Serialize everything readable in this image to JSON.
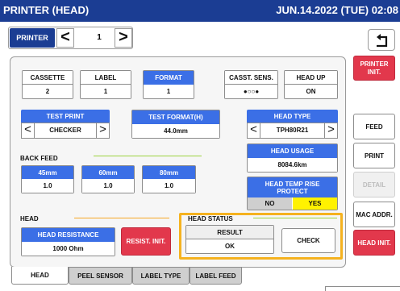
{
  "window": {
    "title": "PRINTER (HEAD)",
    "datetime": "JUN.14.2022 (TUE) 02:08"
  },
  "selector": {
    "label": "PRINTER",
    "prev": "<",
    "value": "1",
    "next": ">"
  },
  "top_row": {
    "cassette": {
      "header": "CASSETTE",
      "value": "2"
    },
    "label": {
      "header": "LABEL",
      "value": "1"
    },
    "format": {
      "header": "FORMAT",
      "value": "1"
    },
    "casst_sens": {
      "header": "CASST. SENS.",
      "value": "●○○●"
    },
    "head_up": {
      "header": "HEAD UP",
      "value": "ON"
    }
  },
  "test_print": {
    "header": "TEST PRINT",
    "value": "CHECKER",
    "prev": "<",
    "next": ">"
  },
  "test_format": {
    "header": "TEST FORMAT(H)",
    "value": "44.0mm"
  },
  "head_type": {
    "header": "HEAD TYPE",
    "value": "TPH80R21",
    "prev": "<",
    "next": ">"
  },
  "head_usage": {
    "header": "HEAD USAGE",
    "value": "8084.6km"
  },
  "back_feed": {
    "title": "BACK FEED",
    "items": [
      {
        "header": "45mm",
        "value": "1.0"
      },
      {
        "header": "60mm",
        "value": "1.0"
      },
      {
        "header": "80mm",
        "value": "1.0"
      }
    ]
  },
  "head_temp": {
    "header": "HEAD TEMP RISE PROTECT",
    "no": "NO",
    "yes": "YES"
  },
  "head_section": {
    "title": "HEAD",
    "resistance_header": "HEAD RESISTANCE",
    "resistance_value": "1000 Ohm",
    "resist_init": "RESIST. INIT."
  },
  "head_status": {
    "title": "HEAD STATUS",
    "result_header": "RESULT",
    "result_value": "OK",
    "check": "CHECK"
  },
  "side_buttons": {
    "printer_init": "PRINTER INIT.",
    "feed": "FEED",
    "print": "PRINT",
    "detail": "DETAIL",
    "mac_addr": "MAC ADDR.",
    "head_init": "HEAD INIT."
  },
  "tabs": [
    "HEAD",
    "PEEL SENSOR",
    "LABEL TYPE",
    "LABEL FEED"
  ],
  "colors": {
    "title_bar": "#1b3d93",
    "header_blue": "#3b6fe6",
    "accent_red": "#e2384c",
    "highlight_orange": "#f5b21f",
    "yes_yellow": "#fff200"
  }
}
